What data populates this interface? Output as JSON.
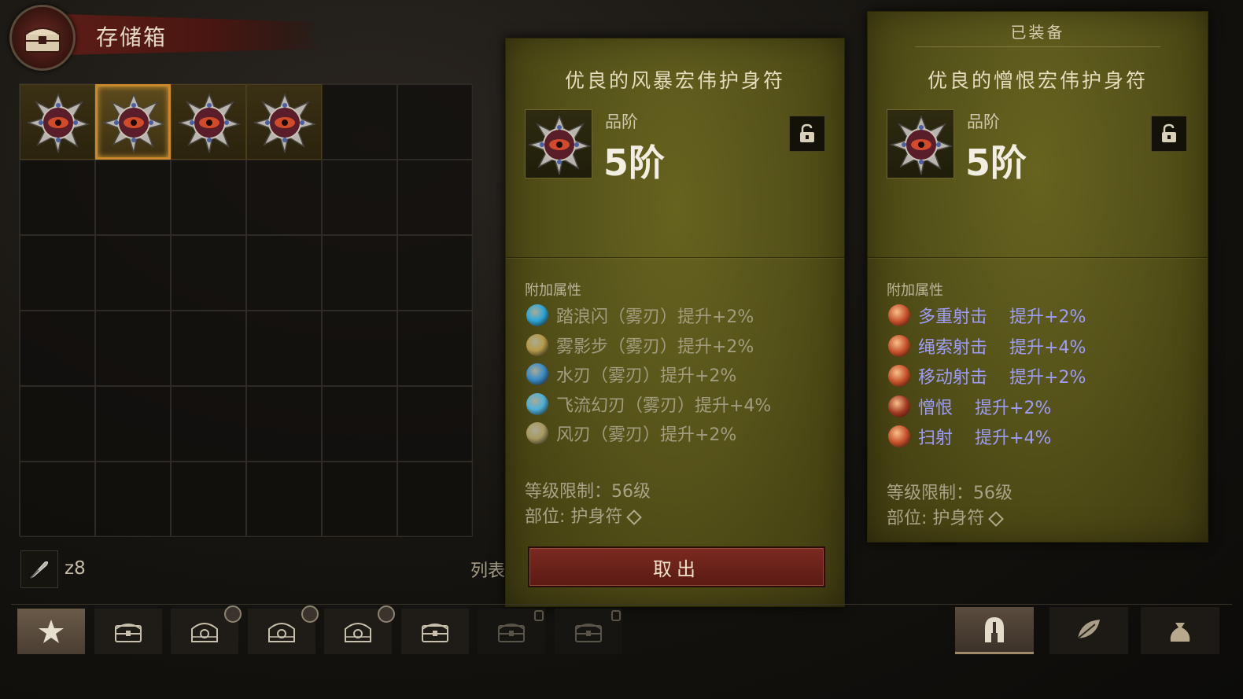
{
  "header": {
    "title": "存储箱"
  },
  "storage": {
    "columns": 6,
    "rows": 6,
    "items": [
      {
        "name": "amulet",
        "selected": false
      },
      {
        "name": "amulet",
        "selected": true
      },
      {
        "name": "amulet",
        "selected": false
      },
      {
        "name": "amulet",
        "selected": false
      }
    ],
    "currency_count": "z8",
    "list_label": "列表"
  },
  "left_card": {
    "item_name": "优良的风暴宏伟护身符",
    "tier_label": "品阶",
    "tier_value": "5阶",
    "attr_title": "附加属性",
    "attributes": [
      {
        "text": "踏浪闪（雾刃）提升+2%",
        "icon_color": "#2fa6d8"
      },
      {
        "text": "雾影步（雾刃）提升+2%",
        "icon_color": "#b59a4a"
      },
      {
        "text": "水刃（雾刃）提升+2%",
        "icon_color": "#3a8cc6"
      },
      {
        "text": "飞流幻刃（雾刃）提升+4%",
        "icon_color": "#4fb0d8"
      },
      {
        "text": "风刃（雾刃）提升+2%",
        "icon_color": "#a89a60"
      }
    ],
    "level_req": "等级限制：56级",
    "slot": "部位: 护身符",
    "take_out_button": "取出"
  },
  "right_card": {
    "equipped_label": "已装备",
    "item_name": "优良的憎恨宏伟护身符",
    "tier_label": "品阶",
    "tier_value": "5阶",
    "attr_title": "附加属性",
    "attributes": [
      {
        "skill": "多重射击",
        "value": "提升+2%",
        "icon_color": "#c4502a"
      },
      {
        "skill": "绳索射击",
        "value": "提升+4%",
        "icon_color": "#c4502a"
      },
      {
        "skill": "移动射击",
        "value": "提升+2%",
        "icon_color": "#c4502a"
      },
      {
        "skill": "憎恨",
        "value": "提升+2%",
        "icon_color": "#a03a22"
      },
      {
        "skill": "扫射",
        "value": "提升+4%",
        "icon_color": "#c4502a"
      }
    ],
    "level_req": "等级限制：56级",
    "slot": "部位: 护身符"
  },
  "bottom_tabs": [
    {
      "icon": "star-icon",
      "active": true
    },
    {
      "icon": "chest-icon"
    },
    {
      "icon": "ornate-chest-icon",
      "timed": true
    },
    {
      "icon": "ornate-chest-icon",
      "timed": true
    },
    {
      "icon": "ornate-chest-icon",
      "timed": true
    },
    {
      "icon": "chest-icon"
    },
    {
      "icon": "chest-icon",
      "locked": true
    },
    {
      "icon": "chest-icon",
      "locked": true
    }
  ],
  "right_tabs": [
    {
      "icon": "helmet-icon",
      "active": true
    },
    {
      "icon": "leaf-material-icon"
    },
    {
      "icon": "bag-icon"
    }
  ],
  "colors": {
    "card_gold": "#56531a",
    "button_red": "#6b221a",
    "attr_blue": "#9e9cf7",
    "selected_border": "#c9892a"
  }
}
